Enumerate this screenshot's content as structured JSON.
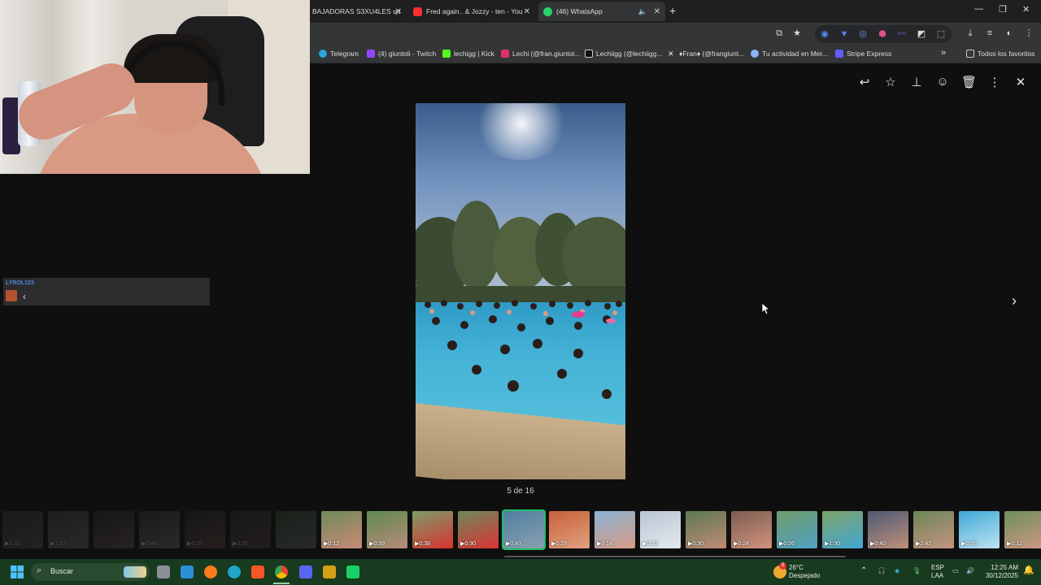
{
  "tabs": [
    {
      "label": "BAJADORAS S3XU4LES qu",
      "favicon_color": "#1f1f1f"
    },
    {
      "label": "Fred again.. & Jozzy - ten - You",
      "favicon_color": "#ff2d2d"
    },
    {
      "label": "(46) WhatsApp",
      "favicon_color": "#25d366",
      "active": true
    }
  ],
  "bookmarks": [
    {
      "label": "Telegram",
      "color": "#2aa3df"
    },
    {
      "label": "(4) giuntoli - Twitch",
      "color": "#9146ff"
    },
    {
      "label": "lechigg | Kick",
      "color": "#53fc18"
    },
    {
      "label": "Lechi (@fran.giuntol...",
      "color": "#e1306c"
    },
    {
      "label": "Lechiigg (@lechiigg...",
      "color": "#ffffff"
    },
    {
      "label": "♦Fran♦ (@frangiunt...",
      "color": "#e0e0e0"
    },
    {
      "label": "Tu actividad en Mer...",
      "color": "#8ab4f8"
    },
    {
      "label": "Stripe Express",
      "color": "#635bff"
    }
  ],
  "bookmarks_more": "»",
  "all_bookmarks": "Todos los favoritos",
  "viewer": {
    "counter": "5 de 16",
    "next": "›"
  },
  "chat": {
    "username": "LYROL123"
  },
  "thumbnails": [
    {
      "dur": "1:31",
      "dim": true,
      "c1": "#3d3d3d",
      "c2": "#5a5a5a"
    },
    {
      "dur": "1:52",
      "dim": true,
      "c1": "#4a4a4a",
      "c2": "#777"
    },
    {
      "dur": "",
      "dim": true,
      "c1": "#2e2e2e",
      "c2": "#6a5a50"
    },
    {
      "dur": "0:46",
      "dim": true,
      "c1": "#3a3a3a",
      "c2": "#7a7a7a"
    },
    {
      "dur": "0:37",
      "dim": true,
      "c1": "#2a2a2a",
      "c2": "#6d4f44"
    },
    {
      "dur": "0:35",
      "dim": true,
      "c1": "#333",
      "c2": "#5d4a42"
    },
    {
      "dur": "",
      "dim": true,
      "c1": "#2f5a34",
      "c2": "#777"
    },
    {
      "dur": "0:12",
      "dim": false,
      "c1": "#6f8a5a",
      "c2": "#c98a76"
    },
    {
      "dur": "0:39",
      "dim": false,
      "c1": "#5e8a4f",
      "c2": "#b78b7a"
    },
    {
      "dur": "0:38",
      "dim": false,
      "c1": "#7d9c6a",
      "c2": "#d8332e"
    },
    {
      "dur": "0:30",
      "dim": false,
      "c1": "#6a8a5c",
      "c2": "#d33"
    },
    {
      "dur": "0:43",
      "dim": false,
      "c1": "#4f7fa0",
      "c2": "#8aa0b0",
      "selected": true
    },
    {
      "dur": "0:29",
      "dim": false,
      "c1": "#c7613a",
      "c2": "#e2a07e"
    },
    {
      "dur": "0:14",
      "dim": false,
      "c1": "#8ab4d6",
      "c2": "#d79a84"
    },
    {
      "dur": "0:12",
      "dim": false,
      "c1": "#b9c6d4",
      "c2": "#e4e8ee"
    },
    {
      "dur": "0:30",
      "dim": false,
      "c1": "#5c7a52",
      "c2": "#c08a76"
    },
    {
      "dur": "0:24",
      "dim": false,
      "c1": "#7a5d52",
      "c2": "#d2927c"
    },
    {
      "dur": "0:06",
      "dim": false,
      "c1": "#6f9c6a",
      "c2": "#4fa0c4"
    },
    {
      "dur": "1:30",
      "dim": false,
      "c1": "#7fa36a",
      "c2": "#41a7d2"
    },
    {
      "dur": "0:40",
      "dim": false,
      "c1": "#4d5a74",
      "c2": "#c08f7b"
    },
    {
      "dur": "2:42",
      "dim": false,
      "c1": "#6b8559",
      "c2": "#c69480"
    },
    {
      "dur": "0:09",
      "dim": false,
      "c1": "#3fa9d8",
      "c2": "#bfe3f0"
    },
    {
      "dur": "0:12",
      "dim": false,
      "c1": "#6c8e5d",
      "c2": "#cf9883"
    }
  ],
  "taskbar": {
    "search_label": "Buscar",
    "weather_temp": "26°C",
    "weather_desc": "Despejado",
    "weather_badge": "3",
    "lang_1": "ESP",
    "lang_2": "LAA",
    "time": "12:25 AM",
    "date": "30/12/2025"
  }
}
